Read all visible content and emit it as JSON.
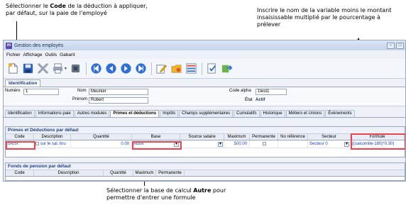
{
  "annotations": {
    "top_left_prefix": "Sélectionner le ",
    "top_left_bold": "Code",
    "top_left_suffix": " de la déduction à appliquer, par défaut, sur la paie de l'employé",
    "top_right": "Inscrire le nom de la variable moins le montant insaisissable multiplié par le pourcentage à prélever",
    "bottom_prefix": "Sélectionner la base de calcul ",
    "bottom_bold": "Autre",
    "bottom_suffix": " pour permettre d'entrer une formule"
  },
  "window": {
    "title": "Gestion des employés",
    "app_icon_letter": "m",
    "buttons": [
      "–",
      "□"
    ]
  },
  "menu": [
    "Fichier",
    "Affichage",
    "Outils",
    "Gabarit"
  ],
  "toolbar_icons": [
    "new-document-icon",
    "save-icon",
    "delete-icon",
    "print-icon",
    "first-record-icon",
    "previous-record-icon",
    "play-icon",
    "next-record-icon",
    "last-record-icon",
    "edit-icon",
    "folder-icon",
    "list-icon",
    "check-icon",
    "export-icon"
  ],
  "identification": {
    "section_label": "Identification",
    "numero_label": "Numéro",
    "numero_value": "1",
    "nom_label": "Nom",
    "nom_value": "Meunier",
    "prenom_label": "Prénom",
    "prenom_value": "Robert",
    "code_alpha_label": "Code alpha",
    "code_alpha_value": "1test1",
    "etat_label": "État",
    "etat_value": "Actif"
  },
  "tabs": [
    "Identification",
    "Informations paie",
    "Autres modules",
    "Primes et déductions",
    "Impôts",
    "Champs supplémentaires",
    "Cumulatifs",
    "Historique",
    "Métiers et Unions",
    "Évènements"
  ],
  "active_tab_index": 3,
  "primes_panel": {
    "title": "Primes et Déductions par défaut",
    "headers": [
      "Code",
      "Description",
      "Quantité",
      "Base",
      "Source salaire",
      "Maximum",
      "Permanente",
      "No référence",
      "Secteur",
      "Formule"
    ],
    "row": {
      "code": "SAISI",
      "description": "sur le sal. bru",
      "quantite": "0.00",
      "base": "Autre",
      "source_salaire": "",
      "maximum": "500.00",
      "no_reference": "",
      "secteur": "Secteur 0",
      "formule": "((salcomite-180)*0.30)"
    }
  },
  "pension_panel": {
    "title": "Fonds de pension par défaut",
    "headers": [
      "Code",
      "Description",
      "Quantité",
      "Maximum",
      "Permanente"
    ]
  },
  "colors": {
    "highlight": "#e8474f",
    "section_title": "#1c3c82",
    "link_blue": "#1a3fb0"
  }
}
